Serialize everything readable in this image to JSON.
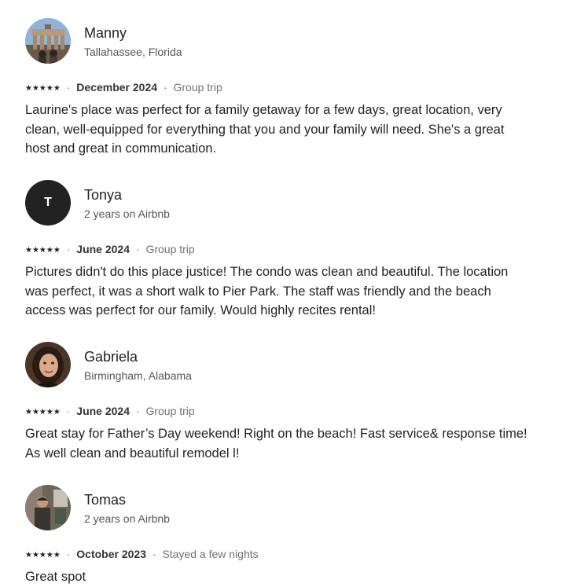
{
  "reviews": [
    {
      "name": "Manny",
      "sub": "Tallahassee, Florida",
      "stars": "★★★★★",
      "date": "December 2024",
      "trip": "Group trip",
      "text": "Laurine's place was perfect for a family getaway for a few days, great location, very clean, well-equipped for everything that you and your family will need. She's a great host and great in communication.",
      "avatar_icon": "photo-avatar-building-icon"
    },
    {
      "name": "Tonya",
      "sub": "2 years on Airbnb",
      "stars": "★★★★★",
      "date": "June 2024",
      "trip": "Group trip",
      "text": "Pictures didn't do this place justice! The condo was clean and beautiful. The location was perfect, it was a short walk to Pier Park. The staff was friendly and the beach access was perfect for our family. Would highly recites rental!",
      "avatar_initial": "T"
    },
    {
      "name": "Gabriela",
      "sub": "Birmingham, Alabama",
      "stars": "★★★★★",
      "date": "June 2024",
      "trip": "Group trip",
      "text": "Great stay for Father’s Day weekend! Right on the beach! Fast service& response time! As well clean and beautiful remodel l!",
      "avatar_icon": "photo-avatar-person-icon"
    },
    {
      "name": "Tomas",
      "sub": "2 years on Airbnb",
      "stars": "★★★★★",
      "date": "October 2023",
      "trip": "Stayed a few nights",
      "text": "Great spot",
      "avatar_icon": "photo-avatar-room-icon"
    }
  ],
  "separator": "·",
  "colors": {
    "text": "#222222",
    "muted": "#717171",
    "initial_avatar_bg": "#222222"
  }
}
